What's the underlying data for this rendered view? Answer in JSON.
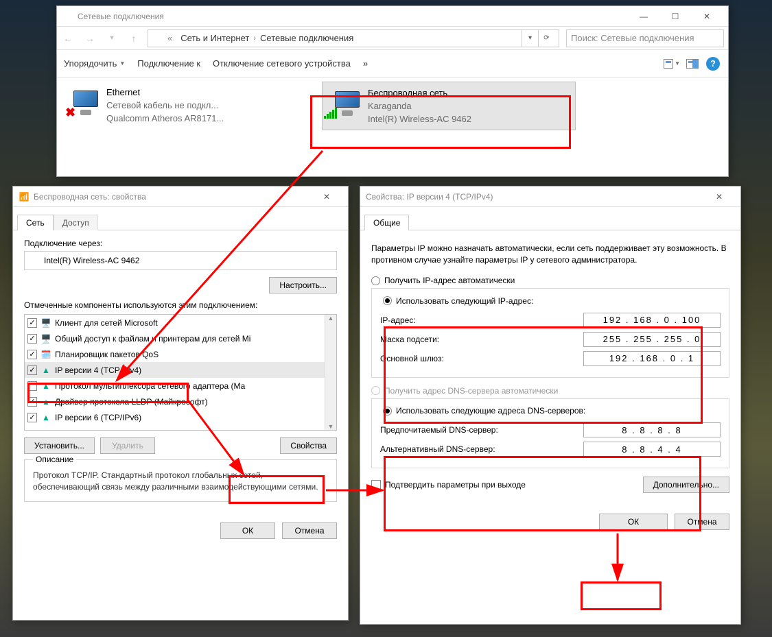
{
  "explorer": {
    "title": "Сетевые подключения",
    "breadcrumb": {
      "a": "Сеть и Интернет",
      "b": "Сетевые подключения"
    },
    "search_placeholder": "Поиск: Сетевые подключения",
    "toolbar": {
      "organize": "Упорядочить",
      "connect": "Подключение к",
      "disable": "Отключение сетевого устройства",
      "more": "»"
    },
    "items": [
      {
        "name": "Ethernet",
        "status": "Сетевой кабель не подкл...",
        "dev": "Qualcomm Atheros AR8171..."
      },
      {
        "name": "Беспроводная сеть",
        "status": "Karaganda",
        "dev": "Intel(R) Wireless-AC 9462"
      }
    ]
  },
  "props": {
    "title": "Беспроводная сеть: свойства",
    "tabs": {
      "net": "Сеть",
      "access": "Доступ"
    },
    "conn_label": "Подключение через:",
    "device": "Intel(R) Wireless-AC 9462",
    "configure": "Настроить...",
    "list_label": "Отмеченные компоненты используются этим подключением:",
    "items": [
      "Клиент для сетей Microsoft",
      "Общий доступ к файлам и принтерам для сетей Mi",
      "Планировщик пакетов QoS",
      "IP версии 4 (TCP/IPv4)",
      "Протокол мультиплексора сетевого адаптера (Ма",
      "Драйвер протокола LLDP (Майкрософт)",
      "IP версии 6 (TCP/IPv6)"
    ],
    "install": "Установить...",
    "remove": "Удалить",
    "propbtn": "Свойства",
    "desc_title": "Описание",
    "desc": "Протокол TCP/IP. Стандартный протокол глобальных сетей, обеспечивающий связь между различными взаимодействующими сетями.",
    "ok": "ОК",
    "cancel": "Отмена"
  },
  "ipv4": {
    "title": "Свойства: IP версии 4 (TCP/IPv4)",
    "tab": "Общие",
    "para": "Параметры IP можно назначать автоматически, если сеть поддерживает эту возможность. В противном случае узнайте параметры IP у сетевого администратора.",
    "r1": "Получить IP-адрес автоматически",
    "r2": "Использовать следующий IP-адрес:",
    "ip_l": "IP-адрес:",
    "mask_l": "Маска подсети:",
    "gw_l": "Основной шлюз:",
    "ip": "192 . 168 .  0  . 100",
    "mask": "255 . 255 . 255 .  0",
    "gw": "192 . 168 .  0  .  1",
    "r3": "Получить адрес DNS-сервера автоматически",
    "r4": "Использовать следующие адреса DNS-серверов:",
    "dns1_l": "Предпочитаемый DNS-сервер:",
    "dns2_l": "Альтернативный DNS-сервер:",
    "dns1": "8  .  8  .  8  .  8",
    "dns2": "8  .  8  .  4  .  4",
    "confirm": "Подтвердить параметры при выходе",
    "adv": "Дополнительно...",
    "ok": "ОК",
    "cancel": "Отмена"
  }
}
